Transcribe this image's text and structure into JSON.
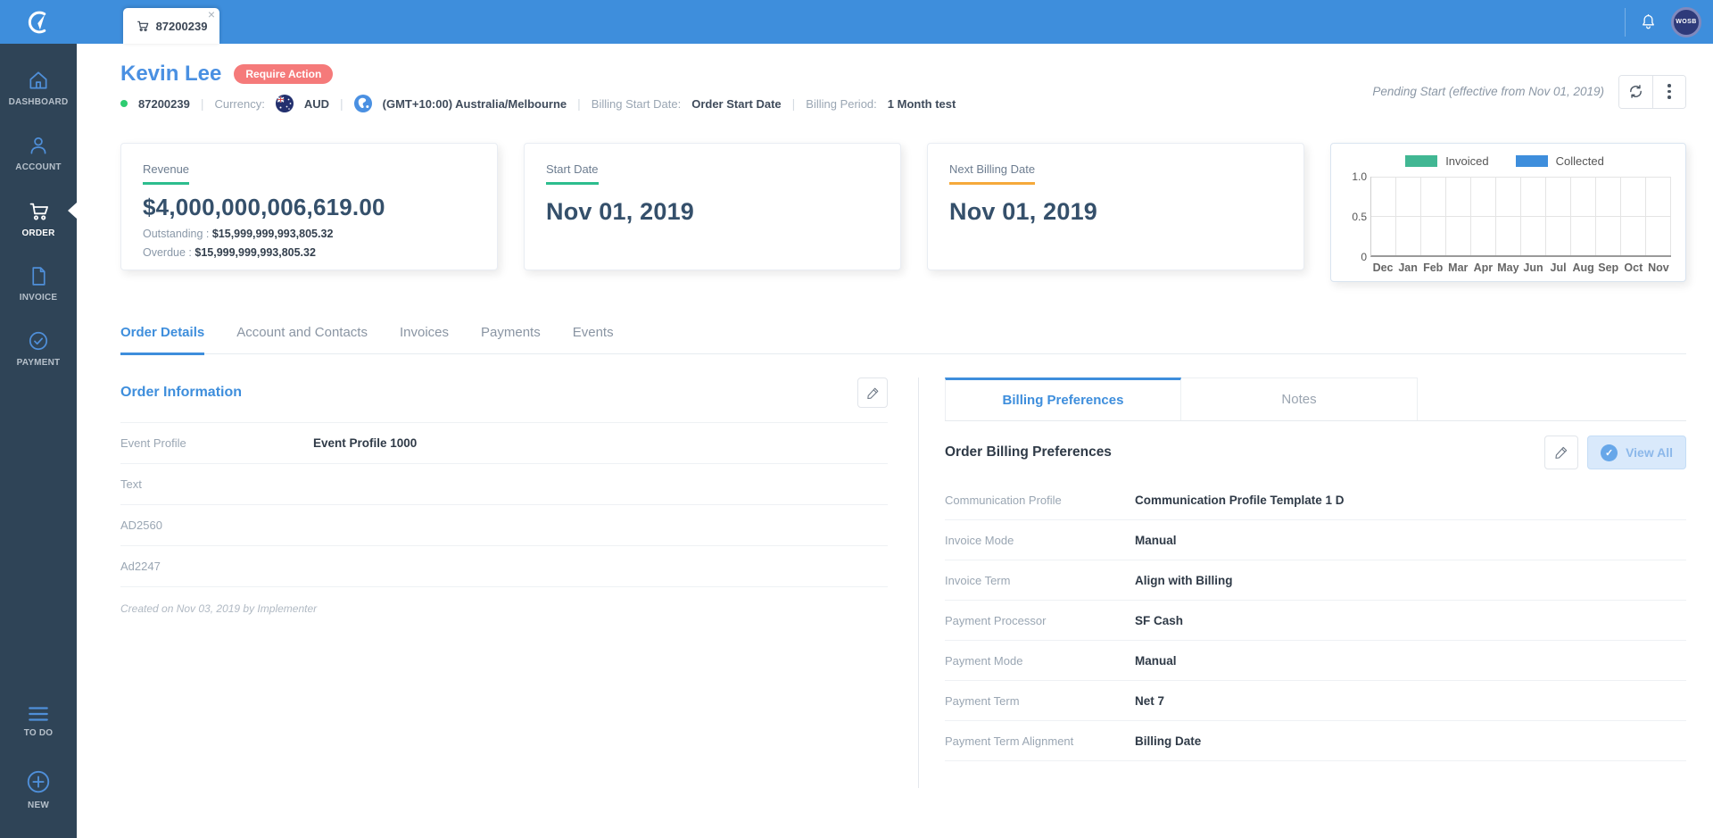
{
  "topbar": {
    "tab_label": "87200239",
    "close_symbol": "×",
    "avatar_text": "WOSB"
  },
  "sidebar": {
    "items": [
      {
        "label": "DASHBOARD",
        "icon": "home-icon"
      },
      {
        "label": "ACCOUNT",
        "icon": "user-icon"
      },
      {
        "label": "ORDER",
        "icon": "cart-icon"
      },
      {
        "label": "INVOICE",
        "icon": "document-icon"
      },
      {
        "label": "PAYMENT",
        "icon": "check-circle-icon"
      }
    ],
    "bottom_items": [
      {
        "label": "TO DO",
        "icon": "menu-icon"
      },
      {
        "label": "NEW",
        "icon": "plus-circle-icon"
      }
    ]
  },
  "header": {
    "name": "Kevin Lee",
    "badge": "Require Action",
    "order_number": "87200239",
    "currency_label": "Currency:",
    "currency_code": "AUD",
    "timezone": "(GMT+10:00) Australia/Melbourne",
    "billing_start_label": "Billing Start Date:",
    "billing_start_value": "Order Start Date",
    "billing_period_label": "Billing Period:",
    "billing_period_value": "1 Month test",
    "status_text": "Pending Start (effective from Nov 01, 2019)"
  },
  "cards": {
    "revenue": {
      "title": "Revenue",
      "value": "$4,000,000,006,619.00",
      "outstanding_label": "Outstanding :",
      "outstanding_value": "$15,999,999,993,805.32",
      "overdue_label": "Overdue :",
      "overdue_value": "$15,999,999,993,805.32",
      "accent": "#2dbd8e"
    },
    "start_date": {
      "title": "Start Date",
      "value": "Nov 01, 2019",
      "accent": "#2dbd8e"
    },
    "next_billing": {
      "title": "Next Billing Date",
      "value": "Nov 01, 2019",
      "accent": "#f5a93b"
    }
  },
  "chart_data": {
    "type": "bar",
    "categories": [
      "Dec",
      "Jan",
      "Feb",
      "Mar",
      "Apr",
      "May",
      "Jun",
      "Jul",
      "Aug",
      "Sep",
      "Oct",
      "Nov"
    ],
    "series": [
      {
        "name": "Invoiced",
        "color": "#41b793",
        "values": [
          0,
          0,
          0,
          0,
          0,
          0,
          0,
          0,
          0,
          0,
          0,
          0
        ]
      },
      {
        "name": "Collected",
        "color": "#3e8edc",
        "values": [
          0,
          0,
          0,
          0,
          0,
          0,
          0,
          0,
          0,
          0,
          0,
          0
        ]
      }
    ],
    "title": "",
    "xlabel": "",
    "ylabel": "",
    "ylim": [
      0,
      1.0
    ],
    "yticks": [
      0,
      0.5,
      1.0
    ],
    "legend_position": "top",
    "grid": true
  },
  "main_tabs": [
    "Order Details",
    "Account and Contacts",
    "Invoices",
    "Payments",
    "Events"
  ],
  "order_info": {
    "title": "Order Information",
    "fields": [
      {
        "label": "Event Profile",
        "value": "Event Profile 1000"
      },
      {
        "label": "Text",
        "value": ""
      },
      {
        "label": "AD2560",
        "value": ""
      },
      {
        "label": "Ad2247",
        "value": ""
      }
    ],
    "created_note": "Created on Nov 03, 2019 by Implementer"
  },
  "billing_panel": {
    "tabs": [
      "Billing Preferences",
      "Notes"
    ],
    "title": "Order Billing Preferences",
    "view_all_label": "View All",
    "check_symbol": "✓",
    "fields": [
      {
        "label": "Communication Profile",
        "value": "Communication Profile Template 1 D"
      },
      {
        "label": "Invoice Mode",
        "value": "Manual"
      },
      {
        "label": "Invoice Term",
        "value": "Align with Billing"
      },
      {
        "label": "Payment Processor",
        "value": "SF Cash"
      },
      {
        "label": "Payment Mode",
        "value": "Manual"
      },
      {
        "label": "Payment Term",
        "value": "Net 7"
      },
      {
        "label": "Payment Term Alignment",
        "value": "Billing Date"
      }
    ]
  },
  "colors": {
    "brand_blue": "#3e8edc",
    "sidebar_navy": "#2f4457",
    "badge_red": "#f57a7a",
    "accent_green": "#2dbd8e",
    "accent_orange": "#f5a93b",
    "value_dark": "#35506b",
    "status_green_dot": "#2ecc71"
  }
}
